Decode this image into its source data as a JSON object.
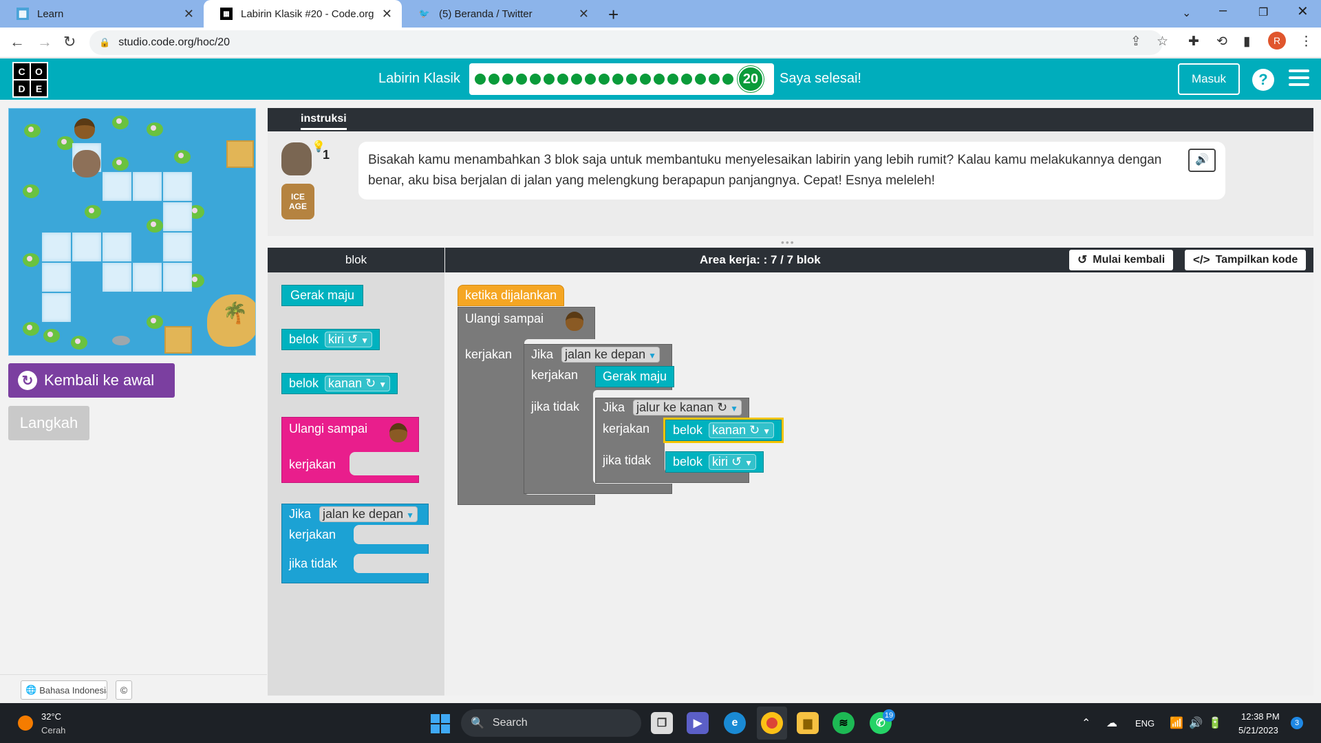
{
  "browser": {
    "tabs": [
      {
        "title": "Learn",
        "active": false,
        "icon": "learn-favicon"
      },
      {
        "title": "Labirin Klasik #20 - Code.org",
        "active": true,
        "icon": "code-org-favicon"
      },
      {
        "title": "(5) Beranda / Twitter",
        "active": false,
        "icon": "twitter-favicon"
      }
    ],
    "url": "studio.code.org/hoc/20",
    "profile_initial": "R"
  },
  "header": {
    "logo_letters": [
      "C",
      "O",
      "D",
      "E"
    ],
    "level_title": "Labirin Klasik",
    "total_dots": 19,
    "current_level": "20",
    "done_label": "Saya selesai!",
    "signin_label": "Masuk",
    "help_label": "?"
  },
  "game": {
    "reset_label": "Kembali ke awal",
    "step_label": "Langkah"
  },
  "footer": {
    "language": "Bahasa Indonesia",
    "copyright": "©"
  },
  "instructions": {
    "tab_label": "instruksi",
    "hint_count": "1",
    "ice_age_logo": "ICE AGE",
    "text": "Bisakah kamu menambahkan 3 blok saja untuk membantuku menyelesaikan labirin yang lebih rumit? Kalau kamu melakukannya dengan benar, aku bisa berjalan di jalan yang melengkung berapapun panjangnya. Cepat! Esnya meleleh!"
  },
  "editor": {
    "toolbox_label": "blok",
    "workspace_label": "Area kerja: : 7 / 7 blok",
    "restart_label": "Mulai kembali",
    "show_code_label": "Tampilkan kode",
    "toolbox_blocks": {
      "move": "Gerak maju",
      "turn": "belok",
      "left": "kiri ↺",
      "right": "kanan ↻",
      "repeat": "Ulangi sampai",
      "do": "kerjakan",
      "if": "Jika",
      "path_ahead": "jalan ke depan",
      "else": "jika tidak"
    },
    "program": {
      "when_run": "ketika dijalankan",
      "repeat": "Ulangi sampai",
      "do": "kerjakan",
      "if": "Jika",
      "path_ahead": "jalan ke depan",
      "move": "Gerak maju",
      "else": "jika tidak",
      "path_right": "jalur ke kanan ↻",
      "turn": "belok",
      "right": "kanan ↻",
      "left": "kiri ↺"
    }
  },
  "taskbar": {
    "temperature": "32°C",
    "condition": "Cerah",
    "search": "Search",
    "whatsapp_badge": "19",
    "language": "ENG",
    "time": "12:38 PM",
    "date": "5/21/2023",
    "notifications": "3"
  }
}
